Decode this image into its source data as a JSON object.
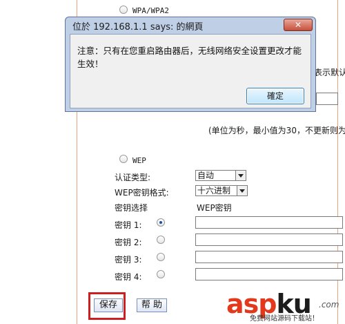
{
  "security": {
    "wpa_label": "WPA/WPA2",
    "interval_hint": "(单位为秒，最小值为30，不更新则为",
    "right_hint": "表示默认",
    "wep_label": "WEP",
    "auth_type_label": "认证类型:",
    "auth_type_value": "自动",
    "key_format_label": "WEP密钥格式:",
    "key_format_value": "十六进制",
    "key_select_label": "密钥选择",
    "wep_key_header": "WEP密钥",
    "keys": [
      {
        "label": "密钥 1:",
        "selected": true,
        "value": ""
      },
      {
        "label": "密钥 2:",
        "selected": false,
        "value": ""
      },
      {
        "label": "密钥 3:",
        "selected": false,
        "value": ""
      },
      {
        "label": "密钥 4:",
        "selected": false,
        "value": ""
      }
    ],
    "save_label": "保存",
    "help_label": "帮 助"
  },
  "dialog": {
    "title": "位於 192.168.1.1 says: 的網頁",
    "message": "注意：只有在您重启路由器后，无线网络安全设置更改才能生效！",
    "ok_label": "確定",
    "close_label": "✕"
  },
  "watermark": {
    "asp": "asp",
    "ku": "ku",
    "com": ".com",
    "sub": "免费网站源码下载站！"
  },
  "colors": {
    "border_accent": "#e8a37a",
    "highlight_red": "#cc1f1f",
    "dialog_frame": "#bfcfe6",
    "close_red": "#c6503a"
  }
}
